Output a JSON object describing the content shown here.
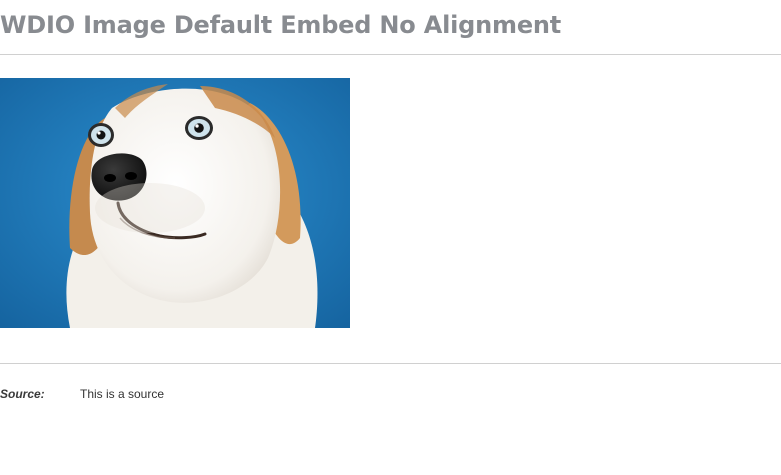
{
  "heading": {
    "title": "WDIO Image Default Embed No Alignment"
  },
  "image": {
    "subject": "dog-photo",
    "background_color": "#1e76b8"
  },
  "source": {
    "label": "Source:",
    "value": "This is a source"
  }
}
